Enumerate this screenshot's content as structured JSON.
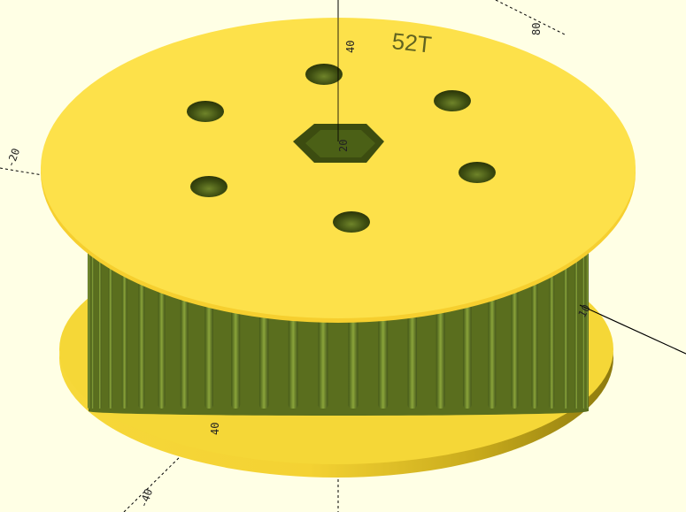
{
  "viewport": {
    "background_color": "#ffffe5",
    "axis_color": "#000000",
    "part_color": "#f7d23a",
    "part_shadow_color": "#8a7a10",
    "tooth_color": "#7e9a2c",
    "tooth_dark_color": "#3e4f10"
  },
  "part": {
    "engraved_text": "52T",
    "teeth_count": 52
  },
  "axis_ticks": {
    "z_upper_label": "40",
    "z_bottom_label": "40",
    "x_right_label": "10",
    "x_far_label": "80",
    "y_left_label": "-20",
    "bottom_label": "-40",
    "center_label": "20"
  }
}
